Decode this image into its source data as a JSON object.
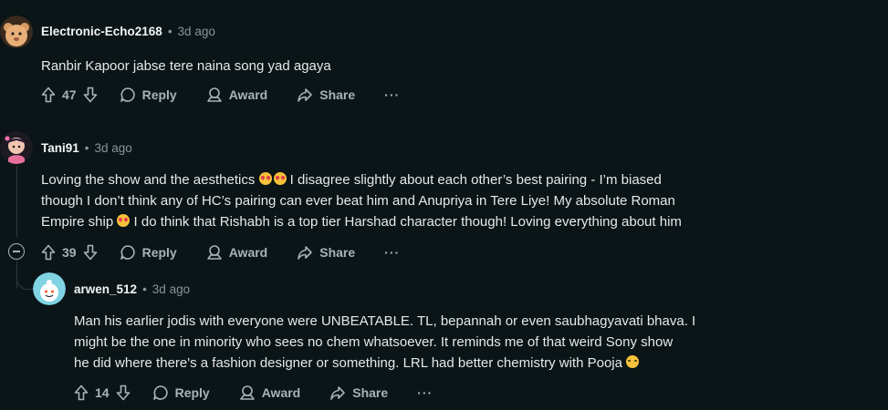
{
  "comments": [
    {
      "author": "Electronic-Echo2168",
      "age": "3d ago",
      "text": "Ranbir Kapoor jabse tere naina song yad agaya",
      "score": "47"
    },
    {
      "author": "Tani91",
      "age": "3d ago",
      "text_1": "Loving the show and the aesthetics ",
      "text_2": " I disagree slightly about each other’s best pairing - I’m biased",
      "text_3": "though I don’t think any of HC’s pairing can ever beat him and Anupriya in Tere Liye! My absolute Roman",
      "text_4": "Empire ship ",
      "text_5": " I do think that Rishabh is a top tier Harshad character though! Loving everything about him",
      "score": "39"
    },
    {
      "author": "arwen_512",
      "age": "3d ago",
      "text_1": "Man his earlier jodis with everyone were UNBEATABLE. TL, bepannah or even saubhagyavati bhava.  I",
      "text_2": "might be the one in minority who sees no chem whatsoever. It reminds me of that weird Sony show",
      "text_3": "he did where there's a fashion designer or something. LRL had better chemistry with Pooja ",
      "score": "14"
    }
  ],
  "actions": {
    "reply": "Reply",
    "award": "Award",
    "share": "Share",
    "more": "···"
  },
  "icons": [
    "upvote-icon",
    "downvote-icon",
    "reply-icon",
    "award-icon",
    "share-icon",
    "more-icon",
    "collapse-icon"
  ],
  "colors": {
    "background": "#0b1416",
    "text": "#e6e9ea",
    "muted": "#8a9599",
    "action": "#a9b3b7",
    "thread_line": "#2f3a3e"
  }
}
